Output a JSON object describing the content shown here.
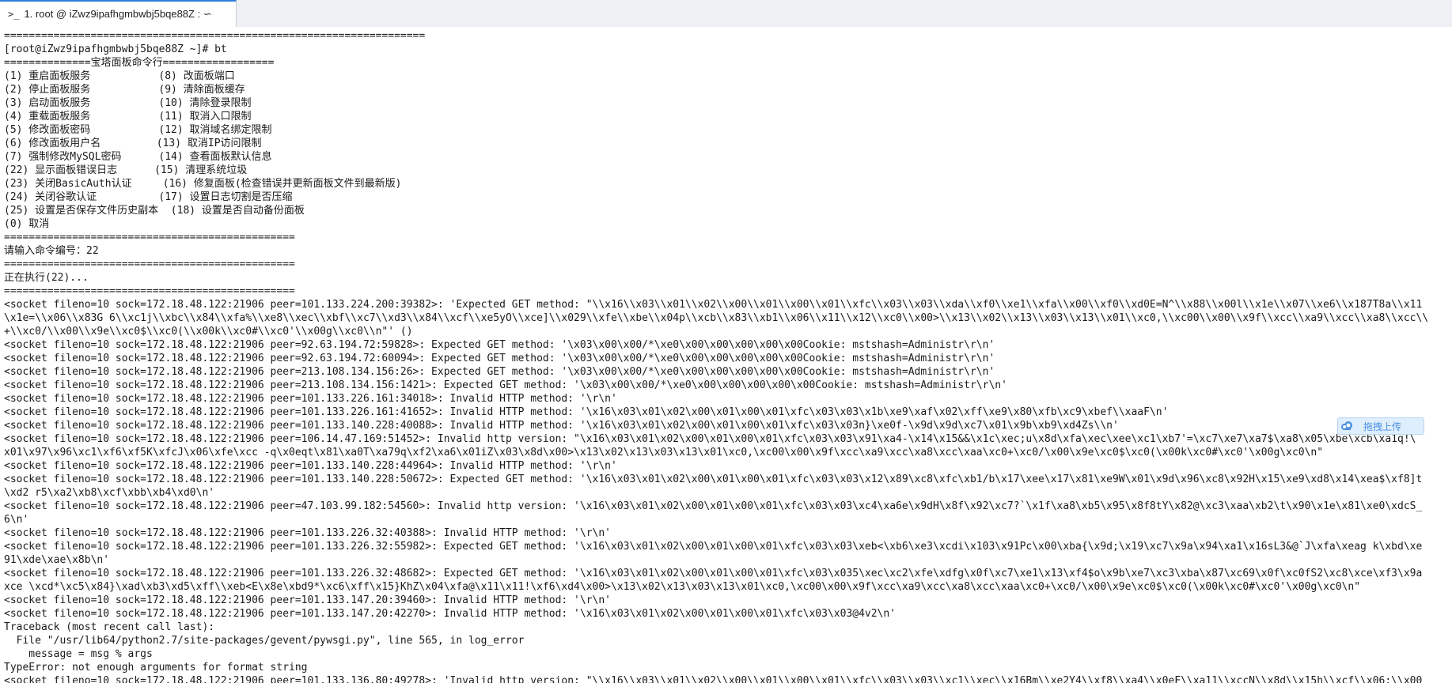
{
  "tab": {
    "icon": "terminal-prompt-icon",
    "label": "1. root @ iZwz9ipafhgmbwbj5bqe88Z : ∽"
  },
  "upload_widget": {
    "icon": "cloud-upload-icon",
    "label": "拖拽上传",
    "accent": "#4a90e2"
  },
  "terminal": {
    "lines": [
      "====================================================================",
      "[root@iZwz9ipafhgmbwbj5bqe88Z ~]# bt",
      "==============宝塔面板命令行==================",
      "(1) 重启面板服务           (8) 改面板端口",
      "(2) 停止面板服务           (9) 清除面板缓存",
      "(3) 启动面板服务           (10) 清除登录限制",
      "(4) 重载面板服务           (11) 取消入口限制",
      "(5) 修改面板密码           (12) 取消域名绑定限制",
      "(6) 修改面板用户名         (13) 取消IP访问限制",
      "(7) 强制修改MySQL密码      (14) 查看面板默认信息",
      "(22) 显示面板错误日志      (15) 清理系统垃圾",
      "(23) 关闭BasicAuth认证     (16) 修复面板(检查错误并更新面板文件到最新版)",
      "(24) 关闭谷歌认证          (17) 设置日志切割是否压缩",
      "(25) 设置是否保存文件历史副本  (18) 设置是否自动备份面板",
      "(0) 取消",
      "===============================================",
      "请输入命令编号：22",
      "===============================================",
      "正在执行(22)...",
      "===============================================",
      "<socket fileno=10 sock=172.18.48.122:21906 peer=101.133.224.200:39382>: 'Expected GET method: \"\\\\x16\\\\x03\\\\x01\\\\x02\\\\x00\\\\x01\\\\x00\\\\x01\\\\xfc\\\\x03\\\\x03\\\\xda\\\\xf0\\\\xe1\\\\xfa\\\\x00\\\\xf0\\\\xd0E=N^\\\\x88\\\\x00l\\\\x1e\\\\x07\\\\xe6\\\\x187T8a\\\\x11",
      "\\x1e=\\\\x06\\\\x83G 6\\\\xc1j\\\\xbc\\\\x84\\\\xfa%\\\\xe8\\\\xec\\\\xbf\\\\xc7\\\\xd3\\\\x84\\\\xcf\\\\xe5yO\\\\xce]\\\\x029\\\\xfe\\\\xbe\\\\x04p\\\\xcb\\\\x83\\\\xb1\\\\x06\\\\x11\\\\x12\\\\xc0\\\\x00>\\\\x13\\\\x02\\\\x13\\\\x03\\\\x13\\\\x01\\\\xc0,\\\\xc00\\\\x00\\\\x9f\\\\xcc\\\\xa9\\\\xcc\\\\xa8\\\\xcc\\\\",
      "+\\\\xc0/\\\\x00\\\\x9e\\\\xc0$\\\\xc0(\\\\x00k\\\\xc0#\\\\xc0'\\\\x00g\\\\xc0\\\\n\"' ()",
      "<socket fileno=10 sock=172.18.48.122:21906 peer=92.63.194.72:59828>: Expected GET method: '\\x03\\x00\\x00/*\\xe0\\x00\\x00\\x00\\x00\\x00Cookie: mstshash=Administr\\r\\n'",
      "<socket fileno=10 sock=172.18.48.122:21906 peer=92.63.194.72:60094>: Expected GET method: '\\x03\\x00\\x00/*\\xe0\\x00\\x00\\x00\\x00\\x00Cookie: mstshash=Administr\\r\\n'",
      "<socket fileno=10 sock=172.18.48.122:21906 peer=213.108.134.156:26>: Expected GET method: '\\x03\\x00\\x00/*\\xe0\\x00\\x00\\x00\\x00\\x00Cookie: mstshash=Administr\\r\\n'",
      "<socket fileno=10 sock=172.18.48.122:21906 peer=213.108.134.156:1421>: Expected GET method: '\\x03\\x00\\x00/*\\xe0\\x00\\x00\\x00\\x00\\x00Cookie: mstshash=Administr\\r\\n'",
      "<socket fileno=10 sock=172.18.48.122:21906 peer=101.133.226.161:34018>: Invalid HTTP method: '\\r\\n'",
      "<socket fileno=10 sock=172.18.48.122:21906 peer=101.133.226.161:41652>: Invalid HTTP method: '\\x16\\x03\\x01\\x02\\x00\\x01\\x00\\x01\\xfc\\x03\\x03\\x1b\\xe9\\xaf\\x02\\xff\\xe9\\x80\\xfb\\xc9\\xbef\\\\xaaF\\n'",
      "<socket fileno=10 sock=172.18.48.122:21906 peer=101.133.140.228:40088>: Invalid HTTP method: '\\x16\\x03\\x01\\x02\\x00\\x01\\x00\\x01\\xfc\\x03\\x03n}\\xe0f-\\x9d\\x9d\\xc7\\x01\\x9b\\xb9\\xd4Zs\\\\n'",
      "<socket fileno=10 sock=172.18.48.122:21906 peer=106.14.47.169:51452>: Invalid http version: \"\\x16\\x03\\x01\\x02\\x00\\x01\\x00\\x01\\xfc\\x03\\x03\\x91\\xa4-\\x14\\x15&&\\x1c\\xec;u\\x8d\\xfa\\xec\\xee\\xc1\\xb7'=\\xc7\\xe7\\xa7$\\xa8\\x05\\xbe\\xcb\\xa1q!\\",
      "x01\\x97\\x96\\xc1\\xf6\\xf5K\\xfcJ\\x06\\xfe\\xcc -q\\x0eqt\\x81\\xa0T\\xa79q\\xf2\\xa6\\x01iZ\\x03\\x8d\\x00>\\x13\\x02\\x13\\x03\\x13\\x01\\xc0,\\xc00\\x00\\x9f\\xcc\\xa9\\xcc\\xa8\\xcc\\xaa\\xc0+\\xc0/\\x00\\x9e\\xc0$\\xc0(\\x00k\\xc0#\\xc0'\\x00g\\xc0\\n\"",
      "<socket fileno=10 sock=172.18.48.122:21906 peer=101.133.140.228:44964>: Invalid HTTP method: '\\r\\n'",
      "<socket fileno=10 sock=172.18.48.122:21906 peer=101.133.140.228:50672>: Expected GET method: '\\x16\\x03\\x01\\x02\\x00\\x01\\x00\\x01\\xfc\\x03\\x03\\x12\\x89\\xc8\\xfc\\xb1/b\\x17\\xee\\x17\\x81\\xe9W\\x01\\x9d\\x96\\xc8\\x92H\\x15\\xe9\\xd8\\x14\\xea$\\xf8]t",
      "\\xd2 r5\\xa2\\xb8\\xcf\\xbb\\xb4\\xd0\\n'",
      "<socket fileno=10 sock=172.18.48.122:21906 peer=47.103.99.182:54560>: Invalid http version: '\\x16\\x03\\x01\\x02\\x00\\x01\\x00\\x01\\xfc\\x03\\x03\\xc4\\xa6e\\x9dH\\x8f\\x92\\xc7?`\\x1f\\xa8\\xb5\\x95\\x8f8tY\\x82@\\xc3\\xaa\\xb2\\t\\x90\\x1e\\x81\\xe0\\xdcS_",
      "6\\n'",
      "<socket fileno=10 sock=172.18.48.122:21906 peer=101.133.226.32:40388>: Invalid HTTP method: '\\r\\n'",
      "<socket fileno=10 sock=172.18.48.122:21906 peer=101.133.226.32:55982>: Expected GET method: '\\x16\\x03\\x01\\x02\\x00\\x01\\x00\\x01\\xfc\\x03\\x03\\xeb<\\xb6\\xe3\\xcdi\\x103\\x91Pc\\x00\\xba{\\x9d;\\x19\\xc7\\x9a\\x94\\xa1\\x16sL3&@`J\\xfa\\xeag k\\xbd\\xe",
      "91\\xde\\xae\\x8b\\n'",
      "<socket fileno=10 sock=172.18.48.122:21906 peer=101.133.226.32:48682>: Expected GET method: '\\x16\\x03\\x01\\x02\\x00\\x01\\x00\\x01\\xfc\\x03\\x035\\xec\\xc2\\xfe\\xdfg\\x0f\\xc7\\xe1\\x13\\xf4$o\\x9b\\xe7\\xc3\\xba\\x87\\xc69\\x0f\\xc0fS2\\xc8\\xce\\xf3\\x9a",
      "xce \\xcd*\\xc5\\x84}\\xad\\xb3\\xd5\\xff\\\\xeb<E\\x8e\\xbd9*\\xc6\\xff\\x15}KhZ\\x04\\xfa@\\x11\\x11!\\xf6\\xd4\\x00>\\x13\\x02\\x13\\x03\\x13\\x01\\xc0,\\xc00\\x00\\x9f\\xcc\\xa9\\xcc\\xa8\\xcc\\xaa\\xc0+\\xc0/\\x00\\x9e\\xc0$\\xc0(\\x00k\\xc0#\\xc0'\\x00g\\xc0\\n\"",
      "<socket fileno=10 sock=172.18.48.122:21906 peer=101.133.147.20:39460>: Invalid HTTP method: '\\r\\n'",
      "<socket fileno=10 sock=172.18.48.122:21906 peer=101.133.147.20:42270>: Invalid HTTP method: '\\x16\\x03\\x01\\x02\\x00\\x01\\x00\\x01\\xfc\\x03\\x03@4v2\\n'",
      "Traceback (most recent call last):",
      "  File \"/usr/lib64/python2.7/site-packages/gevent/pywsgi.py\", line 565, in log_error",
      "    message = msg % args",
      "TypeError: not enough arguments for format string",
      "<socket fileno=10 sock=172.18.48.122:21906 peer=101.133.136.80:49278>: 'Invalid http version: \"\\\\x16\\\\x03\\\\x01\\\\x02\\\\x00\\\\x01\\\\x00\\\\x01\\\\xfc\\\\x03\\\\x03\\\\xc1\\\\xec\\\\x16Bm\\\\xe2Y4\\\\xf8\\\\xa4\\\\x0eF\\\\xa11\\\\xccN\\\\x8d\\\\x15h\\\\xcf\\\\x06:\\\\x00"
    ]
  }
}
